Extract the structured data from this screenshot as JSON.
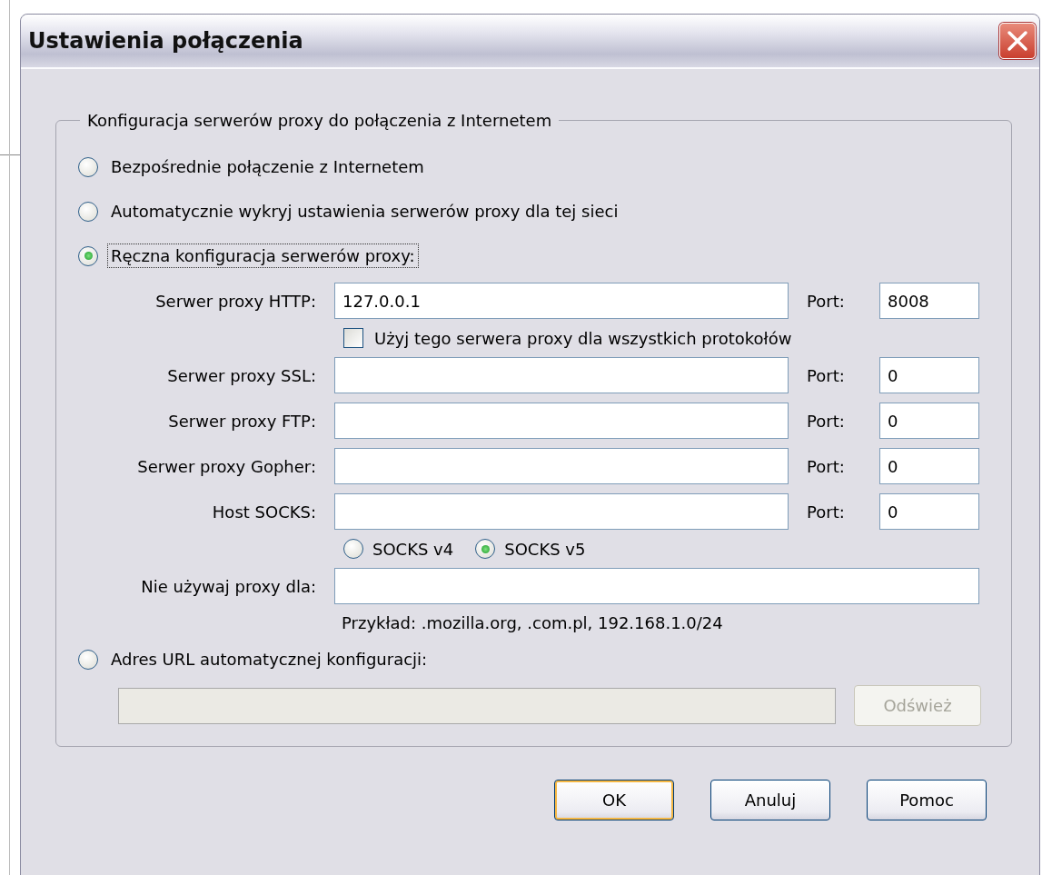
{
  "window": {
    "title": "Ustawienia połączenia"
  },
  "proxy_group": {
    "legend": "Konfiguracja serwerów proxy do połączenia z Internetem",
    "options": [
      {
        "label": "Bezpośrednie połączenie z Internetem",
        "selected": false,
        "focused": false
      },
      {
        "label": "Automatycznie wykryj ustawienia serwerów proxy dla tej sieci",
        "selected": false,
        "focused": false
      },
      {
        "label": "Ręczna konfiguracja serwerów proxy:",
        "selected": true,
        "focused": true
      }
    ],
    "servers": [
      {
        "label": "Serwer proxy HTTP:",
        "value": "127.0.0.1",
        "port_label": "Port:",
        "port_value": "8008"
      },
      {
        "label": "Serwer proxy SSL:",
        "port_label": "Port:",
        "port_value": "0"
      },
      {
        "label": "Serwer proxy FTP:",
        "port_label": "Port:",
        "port_value": "0"
      },
      {
        "label": "Serwer proxy Gopher:",
        "port_label": "Port:",
        "port_value": "0"
      },
      {
        "label": "Host SOCKS:",
        "port_label": "Port:",
        "port_value": "0"
      }
    ],
    "use_for_all": {
      "label": "Użyj tego serwera proxy dla wszystkich protokołów",
      "checked": false
    },
    "socks_versions": [
      {
        "label": "SOCKS v4",
        "selected": false
      },
      {
        "label": "SOCKS v5",
        "selected": true
      }
    ],
    "no_proxy": {
      "label": "Nie używaj proxy dla:"
    },
    "example": "Przykład: .mozilla.org, .com.pl, 192.168.1.0/24",
    "auto_url_option": {
      "label": "Adres URL automatycznej konfiguracji:",
      "selected": false
    },
    "auto_url_field": {
      "disabled": true
    },
    "reload_button": {
      "label": "Odśwież",
      "disabled": true
    }
  },
  "buttons": [
    {
      "label": "OK",
      "default": true
    },
    {
      "label": "Anuluj",
      "default": false
    },
    {
      "label": "Pomoc",
      "default": false
    }
  ]
}
